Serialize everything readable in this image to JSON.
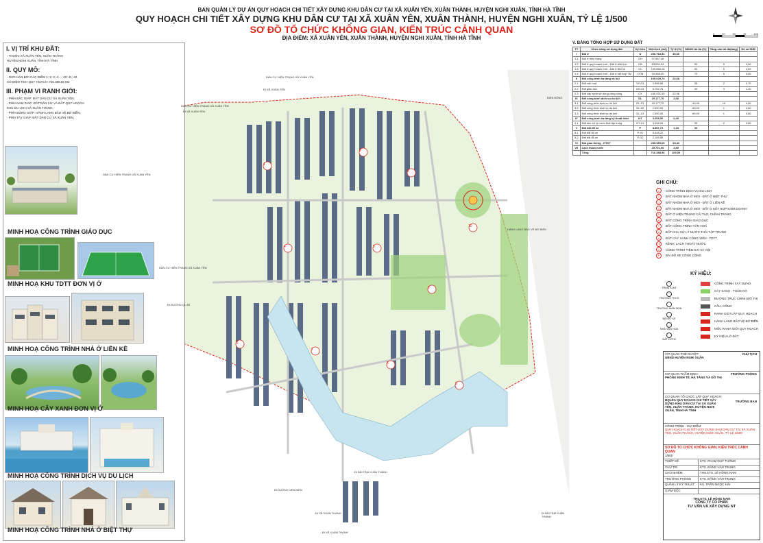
{
  "header": {
    "agency": "BAN QUẢN LÝ DỰ ÁN QUY HOẠCH CHI TIẾT XÂY DỰNG KHU DÂN CƯ TẠI XÃ XUÂN YÊN, XUÂN THÀNH, HUYỆN NGHI XUÂN, TỈNH HÀ TĨNH",
    "title": "QUY HOẠCH CHI TIẾT XÂY DỰNG KHU DÂN CƯ TẠI XÃ XUÂN YÊN, XUÂN THÀNH, HUYỆN NGHI XUÂN, TỶ LỆ 1/500",
    "subtitle": "SƠ ĐỒ TỔ CHỨC KHÔNG GIAN, KIẾN TRÚC CẢNH QUAN",
    "location": "ĐỊA ĐIỂM: XÃ XUÂN YÊN, XUÂN THÀNH, HUYỆN NGHI XUÂN, TỈNH HÀ TĨNH"
  },
  "left": {
    "s1_title": "I. VỊ TRÍ KHU ĐẤT:",
    "s1_lines": [
      "- THUỘC XÃ XUÂN YÊN, XUÂN THÀNH",
      "HUYỆN NGHI XUÂN, TỈNH HÀ TĨNH"
    ],
    "s2_title": "II. QUY MÔ:",
    "s2_lines": [
      "- GIỚI HẠN BỞI CÁC ĐIỂM 1; 2; 3; 4;...; 40; 41; 42.",
      "CÓ DIỆN TÍCH QUY HOẠCH: 716.388,56 M2"
    ],
    "s3_title": "III. PHẠM VI RANH GIỚI:",
    "s3_lines": [
      "- PHÍA BẮC GIÁP: ĐẤT DÂN CƯ XÃ XUÂN YÊN;",
      "- PHÍA NAM GIÁP: ĐẤT DÂN CƯ VÀ ĐẤT QUY HOẠCH",
      "KHU DU LỊCH XÃ XUÂN THÀNH;",
      "- PHÍA ĐÔNG GIÁP: HÀNH LANG BẢO VỆ BỜ BIỂN;",
      "- PHÍA TÂY GIÁP: ĐẤT DÂN CƯ XÃ XUÂN YÊN;"
    ],
    "captions": [
      "MINH HOẠ CÔNG TRÌNH GIÁO DỤC",
      "MINH HOẠ KHU TDTT ĐƠN VỊ Ở",
      "MINH HOẠ CÔNG TRÌNH NHÀ Ở LIỀN KỀ",
      "MINH HOẠ CÂY XANH ĐƠN VỊ Ở",
      "MINH HOẠ CÔNG TRÌNH DỊCH VỤ DU LỊCH",
      "MINH HOẠ CÔNG TRÌNH NHÀ Ở BIỆT THỰ"
    ]
  },
  "map": {
    "labels": [
      "DÂN CƯ HIỆN TRẠNG XÃ XUÂN YÊN",
      "DÂN CƯ HIỆN TRẠNG XÃ XUÂN YÊN",
      "DÂN CƯ HIỆN TRẠNG XÃ XUÂN YÊN",
      "DÂN CƯ HIỆN TRẠNG XÃ XUÂN YÊN",
      "ĐI XÃ XUÂN YÊN",
      "ĐI XÃ XUÂN YÊN",
      "ĐI ĐƯỜNG QL 8B",
      "ĐI ĐƯỜNG VEN BIỂN",
      "ĐI BÃI TẮM XUÂN THÀNH",
      "ĐI BÃI TẮM XUÂN THÀNH",
      "ĐI XÃ XUÂN THÀNH",
      "ĐI XÃ XUÂN THÀNH",
      "BIỂN ĐÔNG",
      "HÀNH LANG BẢO VỆ BỜ BIỂN"
    ],
    "zone_numbers": [
      "1",
      "2",
      "3",
      "4",
      "5",
      "6",
      "7",
      "8",
      "9",
      "10",
      "11"
    ],
    "scale_ticks": [
      "0",
      "20",
      "50",
      "70",
      "100"
    ]
  },
  "table": {
    "title": "V. BẢNG TỔNG HỢP SỬ DỤNG ĐẤT",
    "headers": [
      "TT",
      "Chức năng sử dụng đất",
      "Ký hiệu",
      "Diện tích (m2)",
      "Tỷ lệ (%)",
      "MĐXD tối đa (%)",
      "Tầng cao tối đa(tầng)",
      "Hệ số SDĐ"
    ],
    "rows": [
      [
        "I",
        "Đất ở",
        "O",
        "250.763,54",
        "35,00",
        "",
        "",
        ""
      ],
      [
        "1.1",
        "Đất ở hiện trạng",
        "OH",
        "37.567,46",
        "",
        "",
        "",
        ""
      ],
      [
        "1.2",
        "Đất ở quy hoạch mới - Đất ở biệt thự",
        "OB",
        "83.632,93",
        "",
        "90",
        "5",
        "4,00"
      ],
      [
        "1.3",
        "Đất ở quy hoạch mới - Đất ở liền kề",
        "OL",
        "129.565,15",
        "",
        "90",
        "5",
        "4,00"
      ],
      [
        "1.4",
        "Đất ở quy hoạch mới - Đất ở kết hợp TM",
        "OTM",
        "19.968,00",
        "",
        "70",
        "5",
        "3,50"
      ],
      [
        "II",
        "Đất công trình hạ tầng xã hội",
        "",
        "169.629,74",
        "23,68",
        "",
        "",
        ""
      ],
      [
        "2.1",
        "Đất văn hoá",
        "VH-01",
        "1.995,50",
        "",
        "35",
        "2",
        "0,70"
      ],
      [
        "2.2",
        "Đất giáo dục",
        "GD-01",
        "6.702,75",
        "",
        "40",
        "3",
        "1,20"
      ],
      [
        "2.3",
        "Đất cây xanh sử dụng công cộng",
        "CX",
        "160.931,49",
        "22,46",
        "",
        "",
        ""
      ],
      [
        "III",
        "Đất công trình dịch vụ du lịch",
        "DL",
        "19.177,70",
        "2,68",
        "",
        "",
        ""
      ],
      [
        "3.1",
        "Đất công trình dịch vụ du lịch",
        "DL-01",
        "15.177,70",
        "",
        "40,00",
        "10",
        "4,00"
      ],
      [
        "3.2",
        "Đất công trình dịch vụ du lịch",
        "DL-02",
        "2.000,00",
        "",
        "60,00",
        "1",
        "0,60"
      ],
      [
        "3.3",
        "Đất công trình dịch vụ du lịch",
        "DL-03",
        "2.000,00",
        "",
        "60,00",
        "1",
        "0,60"
      ],
      [
        "IV",
        "Đất công trình hạ tầng kỹ thuật khác",
        "HT",
        "3.208,00",
        "0,45",
        "",
        "",
        ""
      ],
      [
        "4.1",
        "Đất khu xử lý nước thải tập trung",
        "HT-01",
        "3.208,00",
        "",
        "30",
        "2",
        "0,60"
      ],
      [
        "V",
        "Đất bãi đỗ xe",
        "P",
        "8.557,72",
        "1,19",
        "30",
        "",
        ""
      ],
      [
        "5.1",
        "Đất bãi đỗ xe",
        "P-01",
        "6.448,22",
        "",
        "",
        "",
        ""
      ],
      [
        "5.2",
        "Đất bãi đỗ xe",
        "P-02",
        "2.109,50",
        "",
        "",
        "",
        ""
      ],
      [
        "VI",
        "Đất giao thông - HTKT",
        "",
        "239.389,00",
        "33,42",
        "",
        "",
        ""
      ],
      [
        "VII",
        "Lạch thoát nước",
        "",
        "25.701,06",
        "3,59",
        "",
        "",
        ""
      ],
      [
        "",
        "Tổng",
        "",
        "716.388,56",
        "100,00",
        "",
        "",
        ""
      ]
    ]
  },
  "notes": {
    "title": "GHI CHÚ:",
    "items": [
      {
        "num": "1",
        "text": "CÔNG TRÌNH DỊCH VỤ DU LỊCH"
      },
      {
        "num": "2",
        "text": "ĐẤT NHÓM NHÀ Ở MỚI - ĐẤT Ở BIỆT THỰ"
      },
      {
        "num": "3",
        "text": "ĐẤT NHÓM NHÀ Ở MỚI - ĐẤT Ở LIỀN KỀ"
      },
      {
        "num": "4",
        "text": "ĐẤT NHÓM NHÀ Ở MỚI - ĐẤT Ở KẾT HỢP KINH DOANH"
      },
      {
        "num": "5",
        "text": "ĐẤT Ở HIỆN TRẠNG CẢI TẠO, CHỈNH TRANG"
      },
      {
        "num": "6",
        "text": "ĐẤT CÔNG TRÌNH GIÁO DỤC"
      },
      {
        "num": "7",
        "text": "ĐẤT CÔNG TRÌNH VĂN HOÁ"
      },
      {
        "num": "8",
        "text": "ĐẤT KHU XỬ LÝ NƯỚC THẢI TẬP TRUNG"
      },
      {
        "num": "9",
        "text": "ĐẤT CÂY XANH CÔNG VIÊN - TDTT"
      },
      {
        "num": "10",
        "text": "KÊNH, LẠCH THOÁT NƯỚC"
      },
      {
        "num": "11",
        "text": "CÔNG TRÌNH TIỆN ÍCH XÃ HỘI"
      },
      {
        "num": "P",
        "text": "BÃI ĐỖ XE CÔNG CỘNG"
      }
    ]
  },
  "symbols": {
    "title": "KÝ HIỆU:",
    "left_items": [
      "TRẠM XLNT",
      "TRƯỜNG THCS",
      "TRƯỜNG MẦM NON",
      "BÃI ĐỖ XE",
      "NHÀ VĂN HOÁ",
      "ĐẤT DVTM"
    ],
    "items": [
      {
        "label": "CÔNG TRÌNH XÂY DỰNG",
        "color": "#e04040"
      },
      {
        "label": "CÂY XANH - THẢM CỎ",
        "color": "#8ed36a"
      },
      {
        "label": "ĐƯỜNG TRỤC CHÍNH ĐÔ THỊ",
        "color": "#bbbbbb"
      },
      {
        "label": "CẦU, CỐNG",
        "color": "#555555"
      },
      {
        "label": "RANH GIỚI LẬP QUY HOẠCH",
        "color": "#d8261c"
      },
      {
        "label": "HÀNH LANG BẢO VỆ BỜ BIỂN",
        "color": "#d8261c"
      },
      {
        "label": "MỐC RANH GIỚI QUY HOẠCH",
        "color": "#d8261c"
      },
      {
        "label": "KÝ HIỆU LÔ ĐẤT",
        "color": "#d8261c"
      }
    ]
  },
  "titleblock": {
    "approve_label": "CƠ QUAN PHÊ DUYỆT:",
    "approve_org": "UBND HUYỆN NGHI XUÂN",
    "approve_role": "CHỦ TỊCH",
    "appraise_label": "CƠ QUAN THẨM ĐỊNH:",
    "appraise_org": "PHÒNG KINH TẾ, HẠ TẦNG VÀ ĐÔ THỊ",
    "appraise_role": "TRƯỞNG PHÒNG",
    "org_label": "CƠ QUAN TỔ CHỨC LẬP QUY HOẠCH:",
    "org_name": "BQLDA QUY HOẠCH CHI TIẾT XÂY DỰNG KHU DÂN CƯ TẠI XÃ XUÂN YÊN, XUÂN THÀNH, HUYỆN NGHI XUÂN, TỈNH HÀ TĨNH",
    "org_role": "TRƯỞNG BAN",
    "project_label": "CÔNG TRÌNH - ĐỊA ĐIỂM:",
    "project_name": "QUY HOẠCH CHI TIẾT XÂY DỰNG KHU DÂN CƯ TẠI XÃ XUÂN YÊN, XUÂN THÀNH, HUYỆN NGHI XUÂN, TỶ LỆ 1/500",
    "drawing_title": "SƠ ĐỒ TỔ CHỨC KHÔNG GIAN, KIẾN TRÚC CẢNH QUAN",
    "scale": "1/500",
    "staff": [
      {
        "role": "THIẾT KẾ",
        "name": "KTS. PHẠM DUY THÔNG"
      },
      {
        "role": "CHỦ TRÌ",
        "name": "KTS. ĐẶNG VĂN TRUNG"
      },
      {
        "role": "CHỦ NHIỆM",
        "name": "THS.KTS. LÊ HỒNG NAM"
      },
      {
        "role": "TRƯỞNG PHÒNG",
        "name": "KTS. ĐẶNG VĂN TRUNG"
      },
      {
        "role": "QUẢN LÝ KỸ THUẬT",
        "name": "KS. TRẦN NGỌC HẢI"
      },
      {
        "role": "GIÁM ĐỐC",
        "name": ""
      }
    ],
    "signer": "THS.KTS. LÊ HỒNG NAM",
    "company_1": "CÔNG TY CỔ PHẦN",
    "company_2": "TƯ VẤN VÀ XÂY DỰNG NT"
  }
}
